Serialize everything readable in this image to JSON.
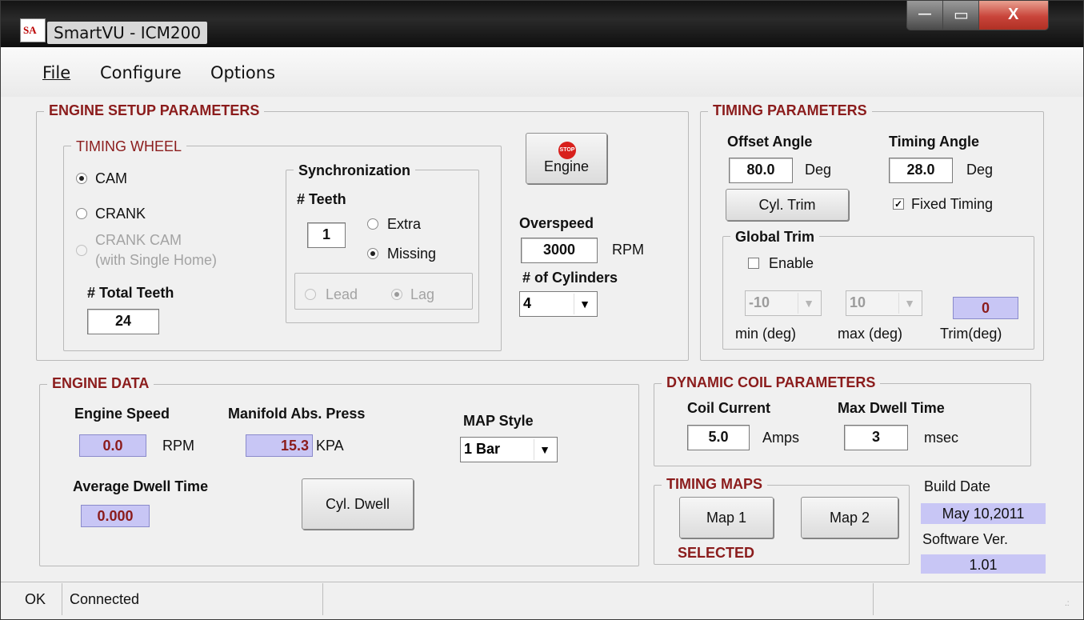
{
  "window": {
    "title": "SmartVU - ICM200",
    "icon_text": "SA",
    "minimize": "—",
    "restore": "▭",
    "close": "X"
  },
  "menu": {
    "file": "File",
    "configure": "Configure",
    "options": "Options"
  },
  "engine_setup": {
    "title": "ENGINE SETUP PARAMETERS",
    "timing_wheel": {
      "title": "TIMING WHEEL",
      "cam": "CAM",
      "crank": "CRANK",
      "crank_cam_line1": "CRANK  CAM",
      "crank_cam_line2": "(with  Single Home)",
      "total_teeth_label": "# Total Teeth",
      "total_teeth_value": "24"
    },
    "sync": {
      "title": "Synchronization",
      "teeth_label": "# Teeth",
      "teeth_value": "1",
      "extra": "Extra",
      "missing": "Missing",
      "lead": "Lead",
      "lag": "Lag"
    },
    "engine_button": "Engine",
    "stop_icon_text": "STOP",
    "overspeed_label": "Overspeed",
    "overspeed_value": "3000",
    "overspeed_unit": "RPM",
    "cylinders_label": "# of Cylinders",
    "cylinders_value": "4"
  },
  "timing": {
    "title": "TIMING PARAMETERS",
    "offset_label": "Offset Angle",
    "offset_value": "80.0",
    "offset_unit": "Deg",
    "timing_label": "Timing Angle",
    "timing_value": "28.0",
    "timing_unit": "Deg",
    "cyl_trim": "Cyl. Trim",
    "fixed_timing": "Fixed Timing",
    "global_trim": {
      "title": "Global Trim",
      "enable": "Enable",
      "min_value": "-10",
      "max_value": "10",
      "trim_value": "0",
      "min_label": "min (deg)",
      "max_label": "max (deg)",
      "trim_label": "Trim(deg)"
    }
  },
  "engine_data": {
    "title": "ENGINE DATA",
    "speed_label": "Engine Speed",
    "speed_value": "0.0",
    "speed_unit": "RPM",
    "map_label": "Manifold Abs. Press",
    "map_value": "15.3",
    "map_unit": "KPA",
    "map_style_label": "MAP Style",
    "map_style_value": "1 Bar",
    "dwell_label": "Average Dwell Time",
    "dwell_value": "0.000",
    "cyl_dwell": "Cyl. Dwell"
  },
  "coil": {
    "title": "DYNAMIC COIL PARAMETERS",
    "current_label": "Coil Current",
    "current_value": "5.0",
    "current_unit": "Amps",
    "dwell_label": "Max Dwell Time",
    "dwell_value": "3",
    "dwell_unit": "msec"
  },
  "maps": {
    "title": "TIMING MAPS",
    "map1": "Map 1",
    "map2": "Map 2",
    "selected": "SELECTED"
  },
  "build": {
    "date_label": "Build Date",
    "date_value": "May  10,2011",
    "ver_label": "Software Ver.",
    "ver_value": "1.01"
  },
  "status": {
    "state": "OK",
    "connection": "Connected"
  },
  "colors": {
    "accent": "#8b1c1c",
    "readonly_bg": "#c8c6f5",
    "close_button": "#c9443a"
  }
}
